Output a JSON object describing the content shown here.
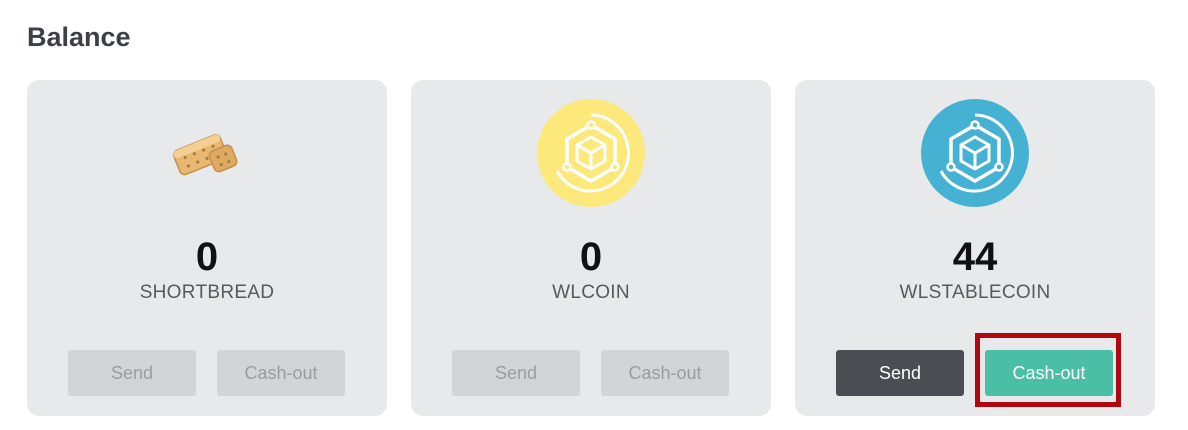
{
  "page": {
    "title": "Balance"
  },
  "cards": [
    {
      "amount": "0",
      "token": "SHORTBREAD",
      "icon": "shortbread-cookie-icon",
      "send_label": "Send",
      "cashout_label": "Cash-out",
      "enabled": false
    },
    {
      "amount": "0",
      "token": "WLCOIN",
      "icon": "wlcoin-icon",
      "icon_color": "#fde87c",
      "send_label": "Send",
      "cashout_label": "Cash-out",
      "enabled": false
    },
    {
      "amount": "44",
      "token": "WLSTABLECOIN",
      "icon": "wlstablecoin-icon",
      "icon_color": "#45b2d3",
      "send_label": "Send",
      "cashout_label": "Cash-out",
      "enabled": true
    }
  ],
  "colors": {
    "send_active": "#4a4d54",
    "cashout_active": "#4bbfa6",
    "disabled": "#d3d4d6",
    "highlight": "#b1070f"
  }
}
